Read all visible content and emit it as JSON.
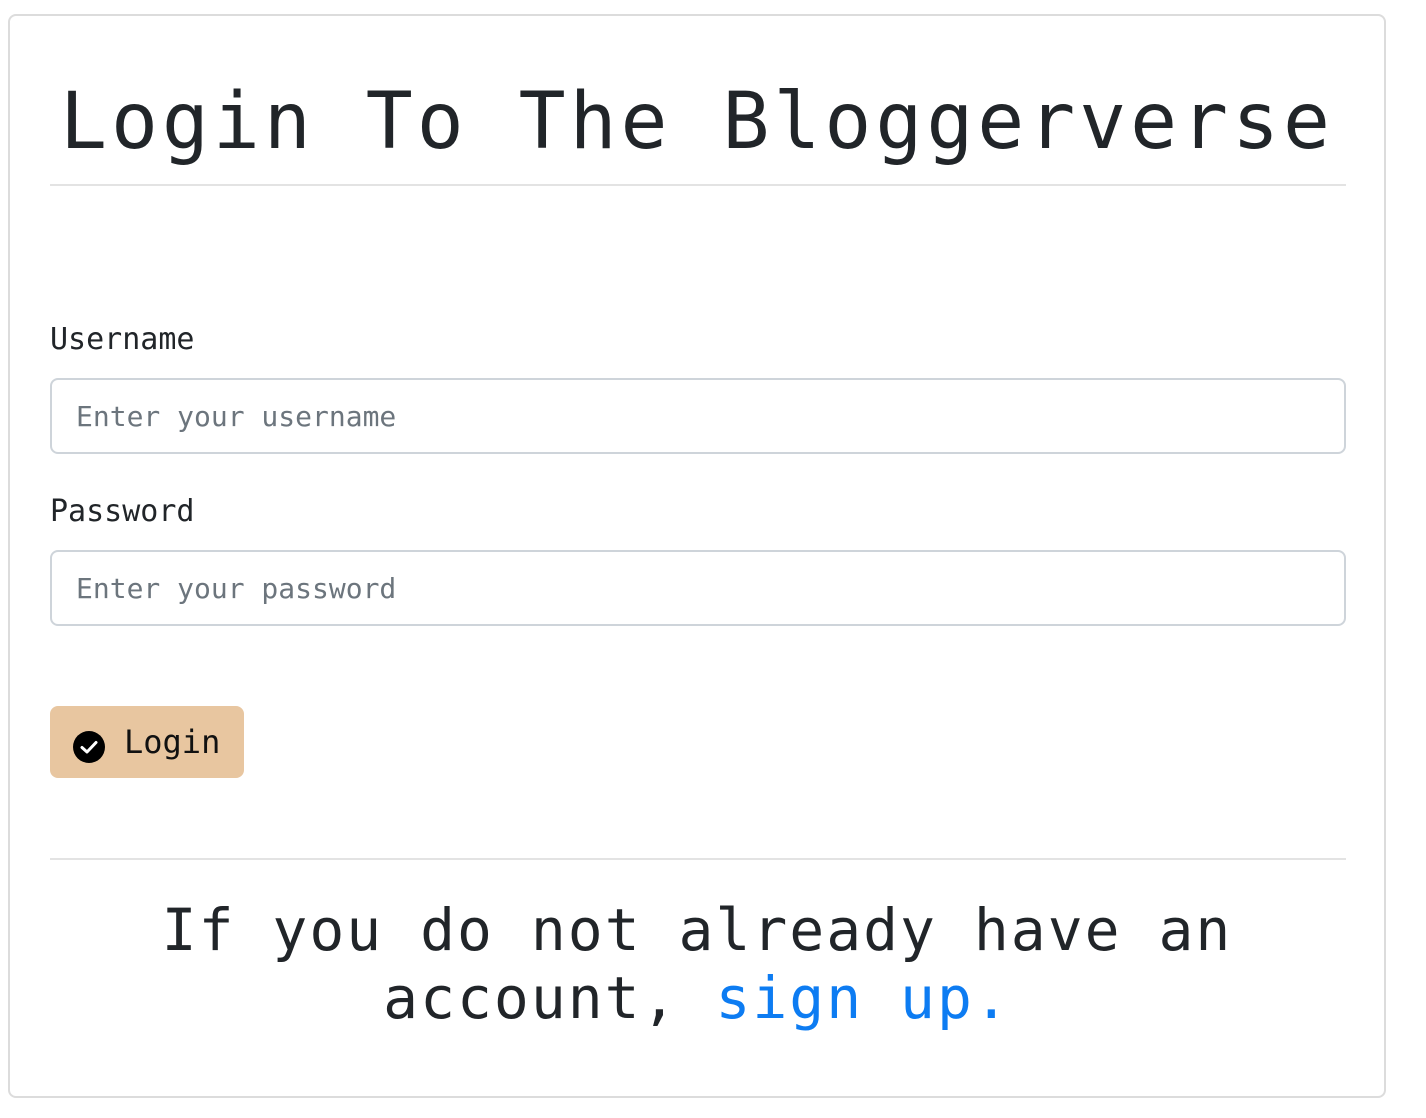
{
  "page": {
    "title": "Login To The Bloggerverse"
  },
  "form": {
    "username_label": "Username",
    "username_placeholder": "Enter your username",
    "username_value": "",
    "password_label": "Password",
    "password_placeholder": "Enter your password",
    "password_value": "",
    "submit_label": "Login",
    "submit_icon": "check-circle-icon",
    "submit_color": "#e8c6a0"
  },
  "footer": {
    "line1": "If you do not already have an",
    "line2_prefix": "account,",
    "signup_link": "sign up.",
    "link_color": "#0d7cf2"
  }
}
